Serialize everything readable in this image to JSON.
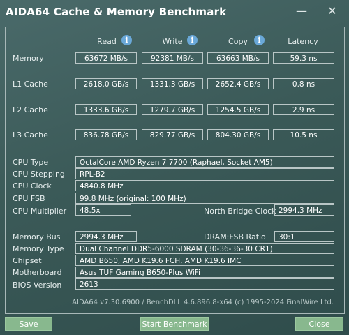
{
  "window": {
    "title": "AIDA64 Cache & Memory Benchmark"
  },
  "headers": {
    "read": "Read",
    "write": "Write",
    "copy": "Copy",
    "latency": "Latency"
  },
  "bench": [
    {
      "label": "Memory",
      "read": "63672 MB/s",
      "write": "92381 MB/s",
      "copy": "63663 MB/s",
      "latency": "59.3 ns"
    },
    {
      "label": "L1 Cache",
      "read": "2618.0 GB/s",
      "write": "1331.3 GB/s",
      "copy": "2652.4 GB/s",
      "latency": "0.8 ns"
    },
    {
      "label": "L2 Cache",
      "read": "1333.6 GB/s",
      "write": "1279.7 GB/s",
      "copy": "1254.5 GB/s",
      "latency": "2.9 ns"
    },
    {
      "label": "L3 Cache",
      "read": "836.78 GB/s",
      "write": "829.77 GB/s",
      "copy": "804.30 GB/s",
      "latency": "10.5 ns"
    }
  ],
  "cpu": {
    "type_label": "CPU Type",
    "type_value": "OctalCore AMD Ryzen 7 7700  (Raphael, Socket AM5)",
    "stepping_label": "CPU Stepping",
    "stepping_value": "RPL-B2",
    "clock_label": "CPU Clock",
    "clock_value": "4840.8 MHz",
    "fsb_label": "CPU FSB",
    "fsb_value": "99.8 MHz  (original: 100 MHz)",
    "multiplier_label": "CPU Multiplier",
    "multiplier_value": "48.5x",
    "nb_clock_label": "North Bridge Clock",
    "nb_clock_value": "2994.3 MHz"
  },
  "memory": {
    "bus_label": "Memory Bus",
    "bus_value": "2994.3 MHz",
    "ratio_label": "DRAM:FSB Ratio",
    "ratio_value": "30:1",
    "type_label": "Memory Type",
    "type_value": "Dual Channel DDR5-6000 SDRAM  (30-36-36-30 CR1)",
    "chipset_label": "Chipset",
    "chipset_value": "AMD B650, AMD K19.6 FCH, AMD K19.6 IMC",
    "motherboard_label": "Motherboard",
    "motherboard_value": "Asus TUF Gaming B650-Plus WiFi",
    "bios_label": "BIOS Version",
    "bios_value": "2613"
  },
  "footer": {
    "text": "AIDA64 v7.30.6900 / BenchDLL 4.6.896.8-x64  (c) 1995-2024 FinalWire Ltd."
  },
  "buttons": {
    "save": "Save",
    "start": "Start Benchmark",
    "close": "Close"
  },
  "colors": {
    "background": "#3f5e5c",
    "button": "#88b88e",
    "info_icon": "#6aa8d8"
  }
}
